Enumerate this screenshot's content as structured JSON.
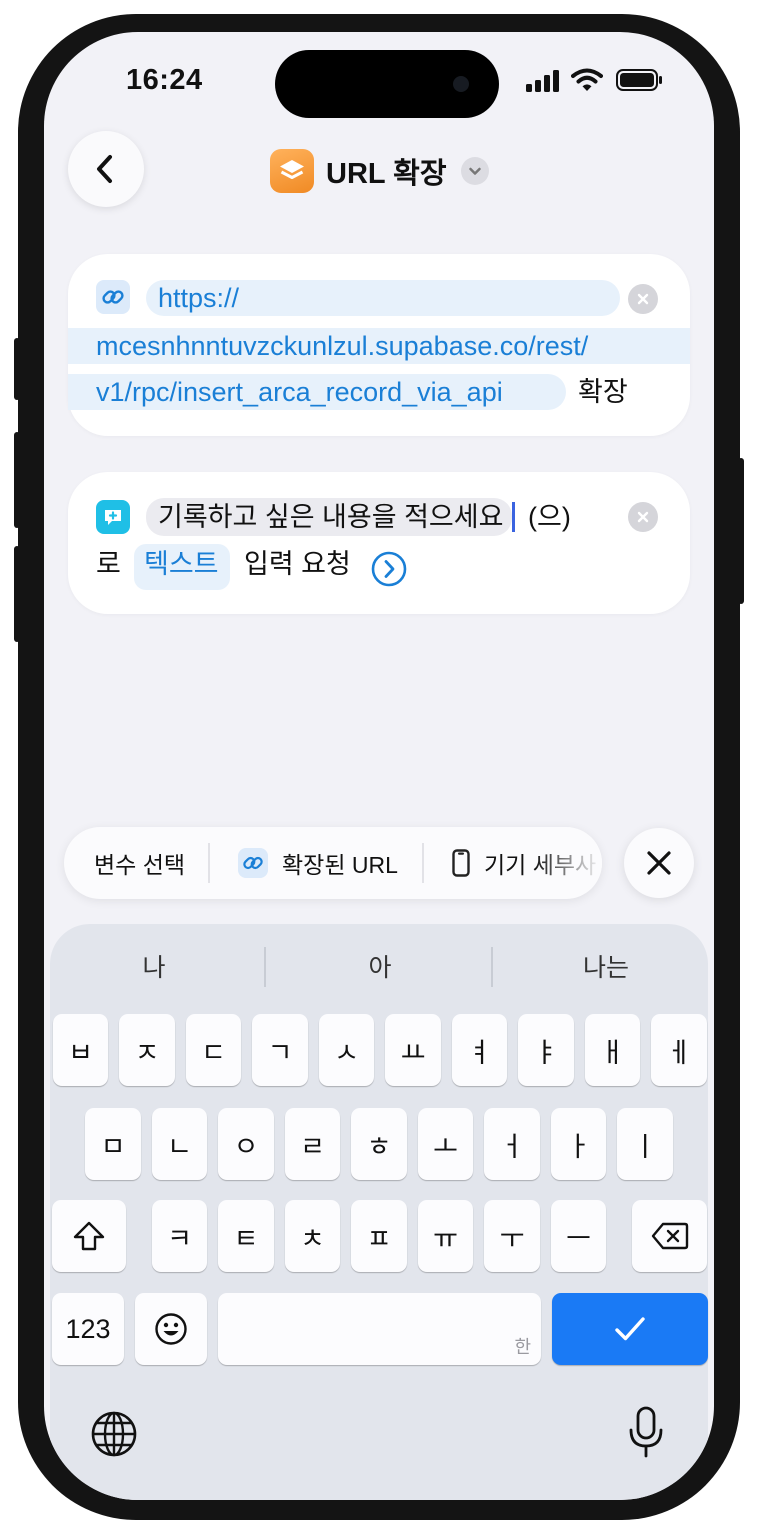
{
  "status_bar": {
    "time": "16:24"
  },
  "nav": {
    "title": "URL 확장"
  },
  "action_expand": {
    "url_line1": "https://",
    "url_line2": "mcesnhnntuvzckunlzul.supabase.co/rest/",
    "url_line3": "v1/rpc/insert_arca_record_via_api",
    "suffix": "확장"
  },
  "action_ask": {
    "prompt": "기록하고 싶은 내용을 적으세요",
    "suffix1": "(으)",
    "prefix2": "로",
    "input_type": "텍스트",
    "suffix2": "입력 요청"
  },
  "variable_bar": {
    "select_label": "변수 선택",
    "expanded_url_label": "확장된 URL",
    "device_details_label": "기기 세부사"
  },
  "keyboard": {
    "suggestions": [
      "나",
      "아",
      "나는"
    ],
    "row1": [
      "ㅂ",
      "ㅈ",
      "ㄷ",
      "ㄱ",
      "ㅅ",
      "ㅛ",
      "ㅕ",
      "ㅑ",
      "ㅐ",
      "ㅔ"
    ],
    "row2": [
      "ㅁ",
      "ㄴ",
      "ㅇ",
      "ㄹ",
      "ㅎ",
      "ㅗ",
      "ㅓ",
      "ㅏ",
      "ㅣ"
    ],
    "row3": [
      "ㅋ",
      "ㅌ",
      "ㅊ",
      "ㅍ",
      "ㅠ",
      "ㅜ",
      "ㅡ"
    ],
    "numbers_label": "123",
    "space_hint": "한",
    "done_symbol": "✓"
  },
  "colors": {
    "accent": "#1a7af5",
    "link": "#1a7fd6",
    "app_icon": "#f59a36"
  }
}
